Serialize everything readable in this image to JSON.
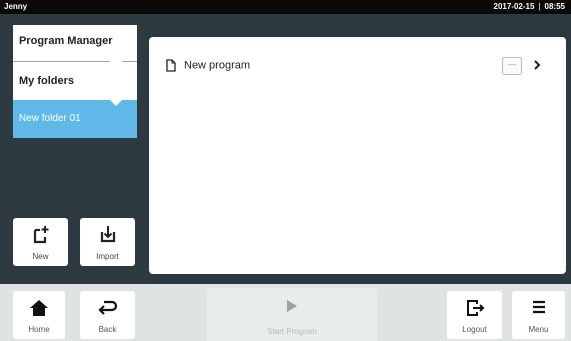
{
  "status_bar": {
    "user": "Jenny",
    "date": "2017-02-15",
    "separator": "|",
    "time": "08:55"
  },
  "sidebar": {
    "items": [
      {
        "label": "Program Manager"
      },
      {
        "label": "My folders"
      },
      {
        "label": "New folder 01",
        "selected": true
      }
    ],
    "actions": [
      {
        "label": "New",
        "icon": "new-file-icon"
      },
      {
        "label": "Import",
        "icon": "import-icon"
      }
    ]
  },
  "main": {
    "items": [
      {
        "label": "New program",
        "icon": "file-icon"
      }
    ],
    "more_label": "···"
  },
  "bottom_bar": {
    "home": {
      "label": "Home",
      "icon": "home-icon"
    },
    "back": {
      "label": "Back",
      "icon": "back-icon"
    },
    "start": {
      "label": "Start Program",
      "icon": "play-icon",
      "enabled": false
    },
    "logout": {
      "label": "Logout",
      "icon": "logout-icon"
    },
    "menu": {
      "label": "Menu",
      "icon": "menu-icon"
    }
  },
  "colors": {
    "accent": "#5fb8e8",
    "dark_panel": "#2d3b40",
    "top_bar": "#0a0a0a",
    "bottom_bar": "#dfe3e4"
  }
}
